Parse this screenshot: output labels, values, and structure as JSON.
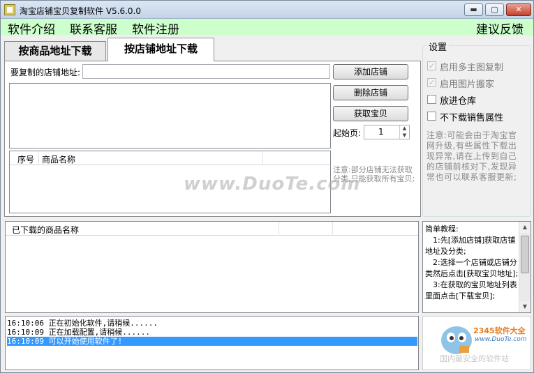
{
  "window": {
    "title": "淘宝店铺宝贝复制软件 V5.6.0.0",
    "min_label": "▬",
    "max_label": "▢",
    "close_label": "✕"
  },
  "menu": {
    "items": [
      "软件介绍",
      "联系客服",
      "软件注册"
    ],
    "feedback": "建议反馈"
  },
  "tabs": [
    {
      "label": "按商品地址下载",
      "active": false
    },
    {
      "label": "按店铺地址下载",
      "active": true
    }
  ],
  "shop_panel": {
    "url_label": "要复制的店铺地址:",
    "url_value": "",
    "add_button": "添加店铺",
    "delete_button": "删除店铺",
    "fetch_button": "获取宝贝",
    "start_page_label": "起始页:",
    "start_page_value": "1",
    "columns": [
      "序号",
      "商品名称"
    ],
    "note": "注意:部分店铺无法获取分类,只能获取所有宝贝;"
  },
  "settings": {
    "title": "设置",
    "options": [
      {
        "label": "启用多主图复制",
        "checked": true,
        "disabled": true
      },
      {
        "label": "启用图片搬家",
        "checked": true,
        "disabled": true
      },
      {
        "label": "放进仓库",
        "checked": false,
        "disabled": false
      },
      {
        "label": "不下载销售属性",
        "checked": false,
        "disabled": false
      }
    ],
    "note": "注意:可能会由于淘宝官网升级,有些属性下载出现异常,请在上传到自己的店铺前核对下,发现异常也可以联系客服更新;"
  },
  "downloaded": {
    "header": "已下载的商品名称"
  },
  "log": [
    {
      "text": "16:10:06 正在初始化软件,请稍候......",
      "selected": false
    },
    {
      "text": "16:10:09 正在加载配置,请稍候......",
      "selected": false
    },
    {
      "text": "16:10:09 可以开始使用软件了!",
      "selected": true
    }
  ],
  "tutorial": {
    "lines": [
      "简单教程:",
      "　1:先[添加店铺]获取店铺地址及分类;",
      "　2:选择一个店铺或店铺分类然后点击[获取宝贝地址];",
      "　3:在获取的宝贝地址列表里面点击[下载宝贝];"
    ]
  },
  "ad": {
    "brand": "2345软件大全",
    "site": "www.DuoTe.com",
    "slogan": "国内最安全的软件站"
  },
  "watermark": "www.DuoTe.com"
}
